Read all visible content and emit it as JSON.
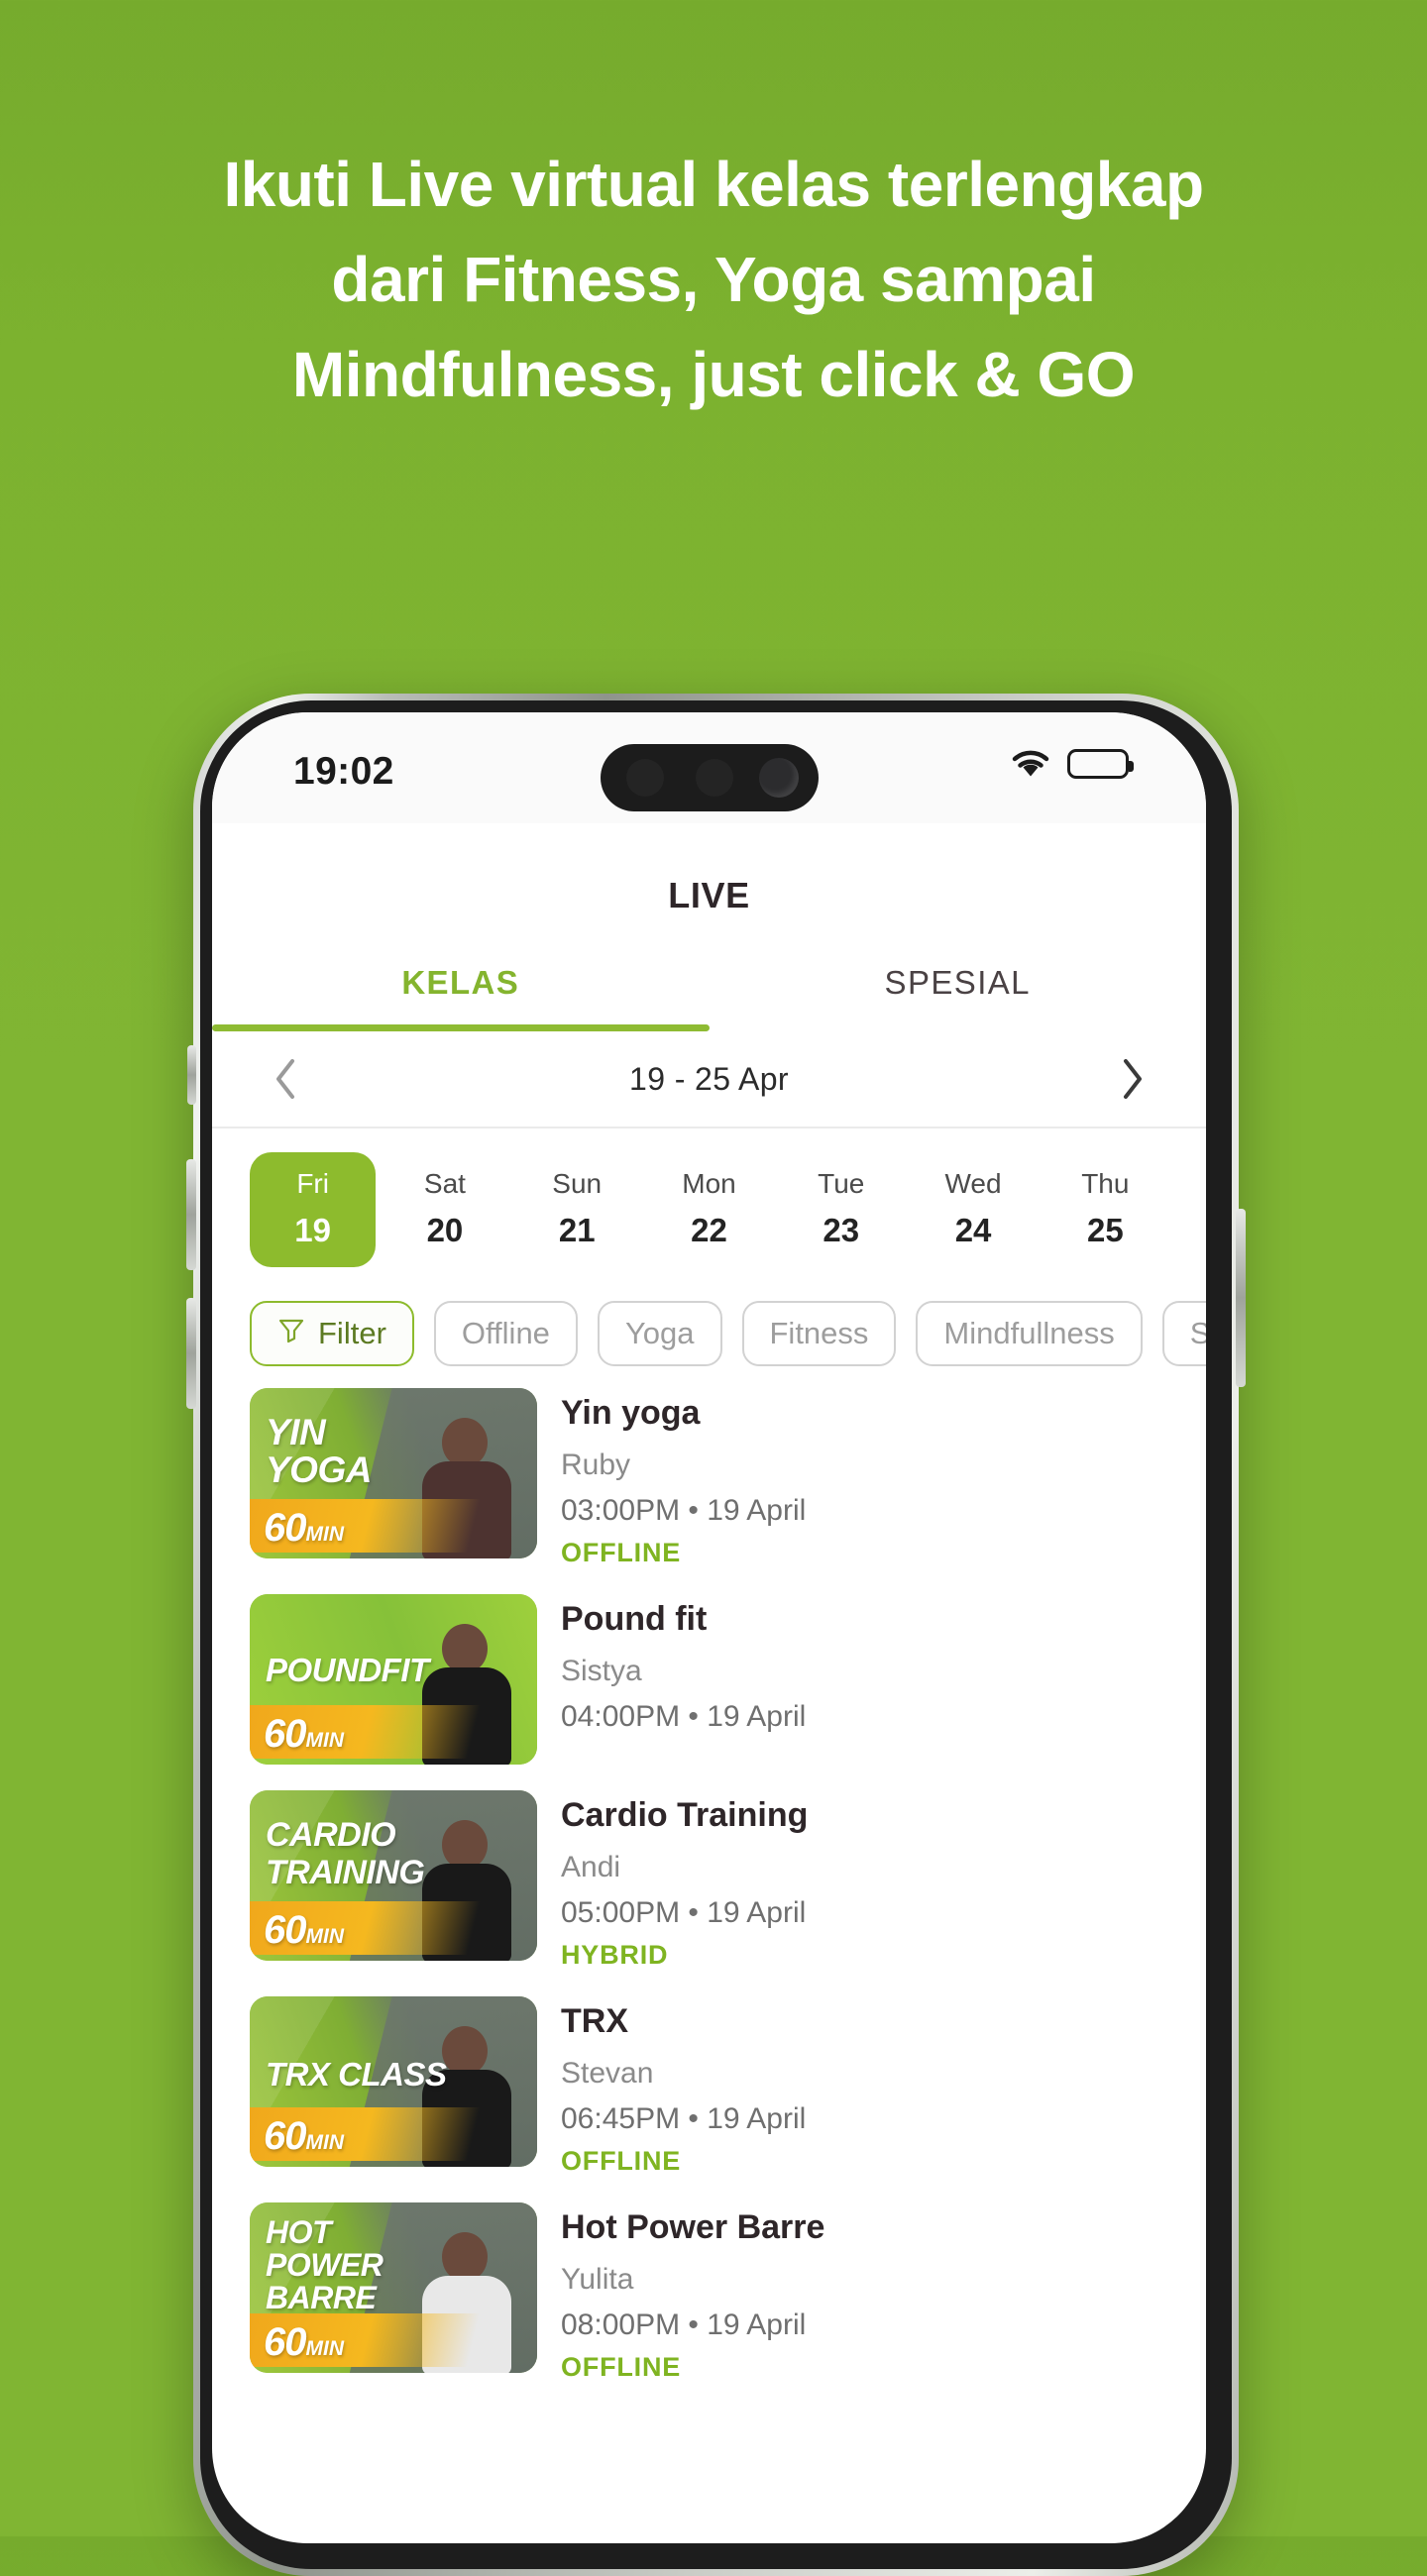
{
  "promo": {
    "headline_lines": [
      "Ikuti Live virtual kelas terlengkap",
      "dari Fitness, Yoga sampai",
      "Mindfulness, just click & GO"
    ]
  },
  "colors": {
    "brand_green": "#80b533",
    "accent_green": "#8dbb2d",
    "badge_green": "#7fb421",
    "ribbon_orange": "#f0a71c"
  },
  "status_bar": {
    "time": "19:02",
    "wifi_icon": "wifi-icon",
    "battery_icon": "battery-icon"
  },
  "app": {
    "title": "LIVE",
    "tabs": [
      {
        "label": "KELAS",
        "active": true
      },
      {
        "label": "SPESIAL",
        "active": false
      }
    ],
    "week_nav": {
      "prev_icon": "chevron-left-icon",
      "next_icon": "chevron-right-icon",
      "range": "19 - 25 Apr"
    },
    "days": [
      {
        "dow": "Fri",
        "num": "19",
        "active": true
      },
      {
        "dow": "Sat",
        "num": "20",
        "active": false
      },
      {
        "dow": "Sun",
        "num": "21",
        "active": false
      },
      {
        "dow": "Mon",
        "num": "22",
        "active": false
      },
      {
        "dow": "Tue",
        "num": "23",
        "active": false
      },
      {
        "dow": "Wed",
        "num": "24",
        "active": false
      },
      {
        "dow": "Thu",
        "num": "25",
        "active": false
      }
    ],
    "filters": [
      {
        "label": "Filter",
        "icon": "filter-icon",
        "primary": true
      },
      {
        "label": "Offline",
        "primary": false
      },
      {
        "label": "Yoga",
        "primary": false
      },
      {
        "label": "Fitness",
        "primary": false
      },
      {
        "label": "Mindfullness",
        "primary": false
      },
      {
        "label": "Sk",
        "primary": false
      }
    ],
    "classes": [
      {
        "name": "Yin yoga",
        "instructor": "Ruby",
        "time": "03:00PM • 19 April",
        "badge": "OFFLINE",
        "thumb_title": "YIN\nYOGA",
        "thumb_duration": "60",
        "thumb_duration_unit": "MIN"
      },
      {
        "name": "Pound fit",
        "instructor": "Sistya",
        "time": "04:00PM • 19 April",
        "badge": "",
        "thumb_title": "POUNDFIT",
        "thumb_duration": "60",
        "thumb_duration_unit": "MIN"
      },
      {
        "name": "Cardio Training",
        "instructor": "Andi",
        "time": "05:00PM • 19 April",
        "badge": "HYBRID",
        "thumb_title": "CARDIO\nTRAINING",
        "thumb_duration": "60",
        "thumb_duration_unit": "MIN"
      },
      {
        "name": "TRX",
        "instructor": "Stevan",
        "time": "06:45PM • 19 April",
        "badge": "OFFLINE",
        "thumb_title": "TRX CLASS",
        "thumb_duration": "60",
        "thumb_duration_unit": "MIN"
      },
      {
        "name": "Hot Power Barre",
        "instructor": "Yulita",
        "time": "08:00PM • 19 April",
        "badge": "OFFLINE",
        "thumb_title": "HOT\nPOWER\nBARRE",
        "thumb_duration": "60",
        "thumb_duration_unit": "MIN"
      }
    ]
  }
}
